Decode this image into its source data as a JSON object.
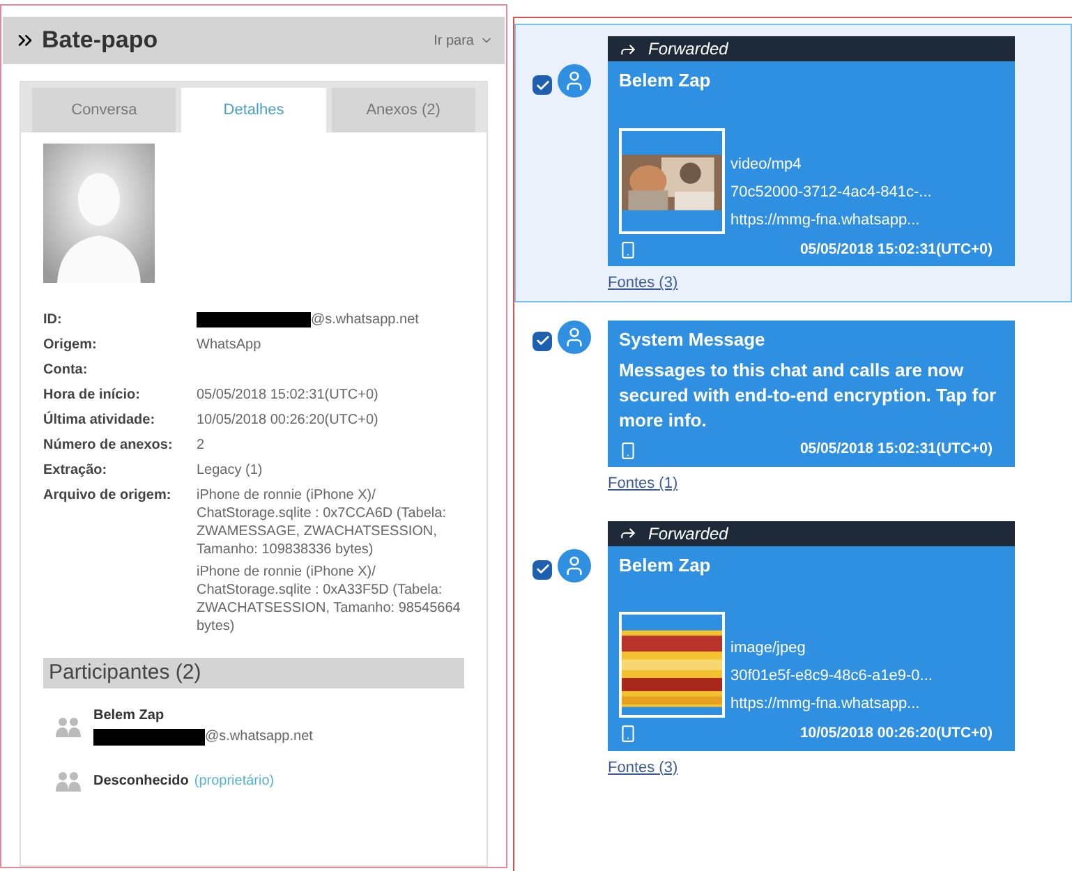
{
  "header": {
    "title": "Bate-papo",
    "menu": "Ir para"
  },
  "tabs": [
    {
      "label": "Conversa",
      "selected": false
    },
    {
      "label": "Detalhes",
      "selected": true
    },
    {
      "label": "Anexos (2)",
      "selected": false
    }
  ],
  "details": [
    {
      "label": "ID:",
      "value": "@s.whatsapp.net",
      "redacted": true
    },
    {
      "label": "Origem:",
      "value": "WhatsApp"
    },
    {
      "label": "Conta:"
    },
    {
      "label": "Hora de início:",
      "value": "05/05/2018 15:02:31(UTC+0)"
    },
    {
      "label": "Última atividade:",
      "value": "10/05/2018 00:26:20(UTC+0)"
    },
    {
      "label": "Número de anexos:",
      "value": "2"
    },
    {
      "label": "Extração:",
      "value": "Legacy (1)"
    },
    {
      "label": "Arquivo de origem:",
      "values": [
        "iPhone de ronnie (iPhone X)/ ChatStorage.sqlite : 0x7CCA6D (Tabela: ZWAMESSAGE, ZWACHATSESSION, Tamanho: 109838336 bytes)",
        "iPhone de ronnie (iPhone X)/ ChatStorage.sqlite : 0xA33F5D (Tabela: ZWACHATSESSION, Tamanho: 98545664 bytes)"
      ]
    }
  ],
  "participants": {
    "title": "Participantes (2)",
    "items": [
      {
        "name": "Belem Zap",
        "id": "@s.whatsapp.net",
        "redacted": true
      },
      {
        "name": "Desconhecido",
        "role": "(proprietário)"
      }
    ]
  },
  "messages": [
    {
      "selected": true,
      "checked": true,
      "forwarded": "Forwarded",
      "sender": "Belem Zap",
      "kind": "attachment",
      "lines": [
        "video/mp4",
        "70c52000-3712-4ac4-841c-...",
        "https://mmg-fna.whatsapp..."
      ],
      "time": "05/05/2018 15:02:31(UTC+0)",
      "sources": "Fontes (3)"
    },
    {
      "selected": false,
      "checked": true,
      "sender": "System Message",
      "kind": "text",
      "text": "Messages to this chat and calls are now secured with end-to-end encryption. Tap for more info.",
      "time": "05/05/2018 15:02:31(UTC+0)",
      "sources": "Fontes (1)"
    },
    {
      "selected": false,
      "checked": true,
      "forwarded": "Forwarded",
      "sender": "Belem Zap",
      "kind": "attachment",
      "lines": [
        "image/jpeg",
        "30f01e5f-e8c9-48c6-a1e9-0...",
        "https://mmg-fna.whatsapp..."
      ],
      "time": "10/05/2018 00:26:20(UTC+0)",
      "sources": "Fontes (3)"
    }
  ]
}
